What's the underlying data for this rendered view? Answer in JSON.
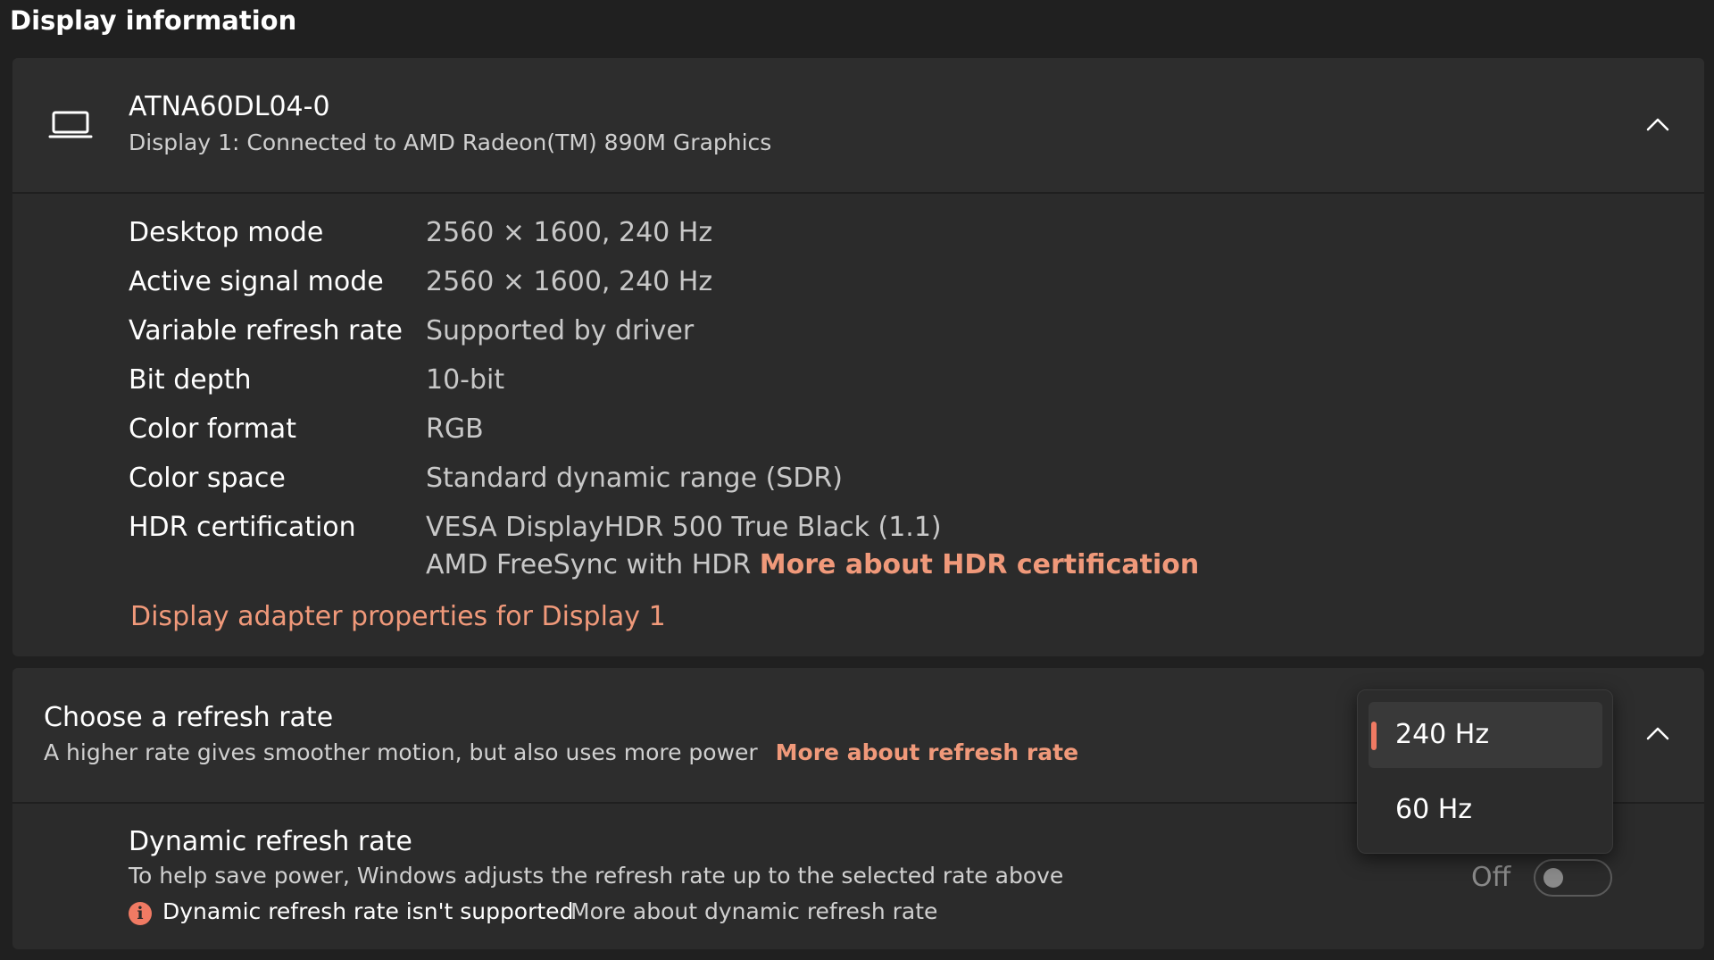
{
  "section": {
    "title": "Display information"
  },
  "display": {
    "name": "ATNA60DL04-0",
    "subtitle": "Display 1: Connected to AMD Radeon(TM) 890M Graphics",
    "icon": "laptop-icon",
    "expanded_icon": "chevron-up-icon",
    "info": [
      {
        "label": "Desktop mode",
        "value": "2560 × 1600, 240 Hz"
      },
      {
        "label": "Active signal mode",
        "value": "2560 × 1600, 240 Hz"
      },
      {
        "label": "Variable refresh rate",
        "value": "Supported by driver"
      },
      {
        "label": "Bit depth",
        "value": "10-bit"
      },
      {
        "label": "Color format",
        "value": "RGB"
      },
      {
        "label": "Color space",
        "value": "Standard dynamic range (SDR)"
      },
      {
        "label": "HDR certification",
        "value": "VESA DisplayHDR 500 True Black (1.1)"
      }
    ],
    "hdr_extra": "AMD FreeSync with HDR",
    "hdr_link": "More about HDR certification",
    "adapter_link": "Display adapter properties for Display 1"
  },
  "refresh": {
    "title": "Choose a refresh rate",
    "subtitle": "A higher rate gives smoother motion, but also uses more power",
    "link": "More about refresh rate",
    "selected": "240 Hz",
    "options": [
      "240 Hz",
      "60 Hz"
    ]
  },
  "dynamic": {
    "title": "Dynamic refresh rate",
    "subtitle": "To help save power, Windows adjusts the refresh rate up to the selected rate above",
    "warning": "Dynamic refresh rate isn't supported",
    "warning_icon": "i",
    "link": "More about dynamic refresh rate",
    "toggle_label": "Off",
    "toggle_on": false
  },
  "colors": {
    "accent": "#f0997a",
    "background": "#202020",
    "card": "#2b2b2b"
  }
}
